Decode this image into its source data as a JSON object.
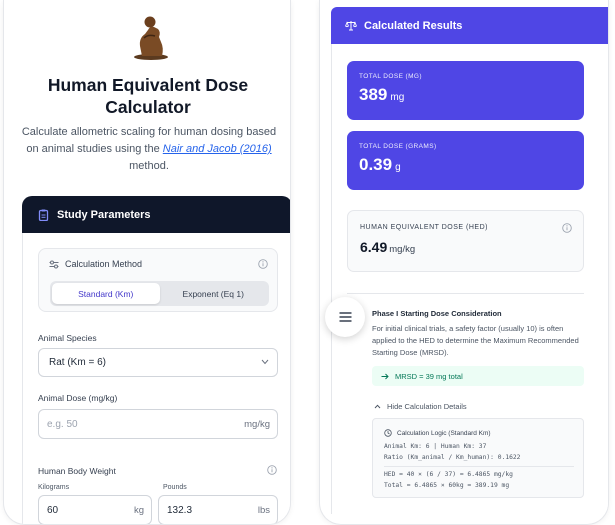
{
  "calculator": {
    "title_line1": "Human Equivalent Dose",
    "title_line2": "Calculator",
    "subtitle_pre": "Calculate allometric scaling for human dosing based on animal studies using the ",
    "subtitle_link": "Nair and Jacob (2016)",
    "subtitle_post": " method."
  },
  "params": {
    "header": "Study Parameters",
    "method_label": "Calculation Method",
    "method_options": [
      "Standard (Km)",
      "Exponent (Eq 1)"
    ],
    "method_selected": "Standard (Km)",
    "species_label": "Animal Species",
    "species_value": "Rat (Km = 6)",
    "dose_label": "Animal Dose (mg/kg)",
    "dose_placeholder": "e.g. 50",
    "dose_unit": "mg/kg",
    "weight_label": "Human Body Weight",
    "kg_label": "Kilograms",
    "kg_value": "60",
    "kg_unit": "kg",
    "lb_label": "Pounds",
    "lb_value": "132.3",
    "lb_unit": "lbs"
  },
  "results": {
    "header": "Calculated Results",
    "total_mg_label": "TOTAL DOSE (MG)",
    "total_mg_value": "389",
    "total_mg_unit": "mg",
    "total_g_label": "TOTAL DOSE (GRAMS)",
    "total_g_value": "0.39",
    "total_g_unit": "g",
    "hed_label": "HUMAN EQUIVALENT DOSE (HED)",
    "hed_value": "6.49",
    "hed_unit": "mg/kg",
    "phase_title": "Phase I Starting Dose Consideration",
    "phase_text": "For initial clinical trials, a safety factor (usually 10) is often applied to the HED to determine the Maximum Recommended Starting Dose (MRSD).",
    "mrsd_text": "MRSD = 39 mg total",
    "hide_details": "Hide Calculation Details",
    "logic_title": "Calculation Logic (Standard Km)",
    "logic_line1": "Animal Km: 6 | Human Km: 37",
    "logic_line2": "Ratio (Km_animal / Km_human): 0.1622",
    "logic_line3": "HED = 40 × (6 / 37) = 6.4865 mg/kg",
    "logic_line4": "Total = 6.4865 × 60kg = 389.19 mg"
  },
  "colors": {
    "accent": "#4f46e5",
    "dark_header": "#0f172a",
    "success_bg": "#ecfdf5",
    "success_text": "#047857"
  },
  "icons": [
    "statue-logo",
    "clipboard-icon",
    "sliders-icon",
    "info-icon",
    "chevron-down-icon",
    "scale-icon",
    "arrow-right-icon",
    "chevron-up-icon",
    "clock-icon",
    "menu-icon"
  ]
}
